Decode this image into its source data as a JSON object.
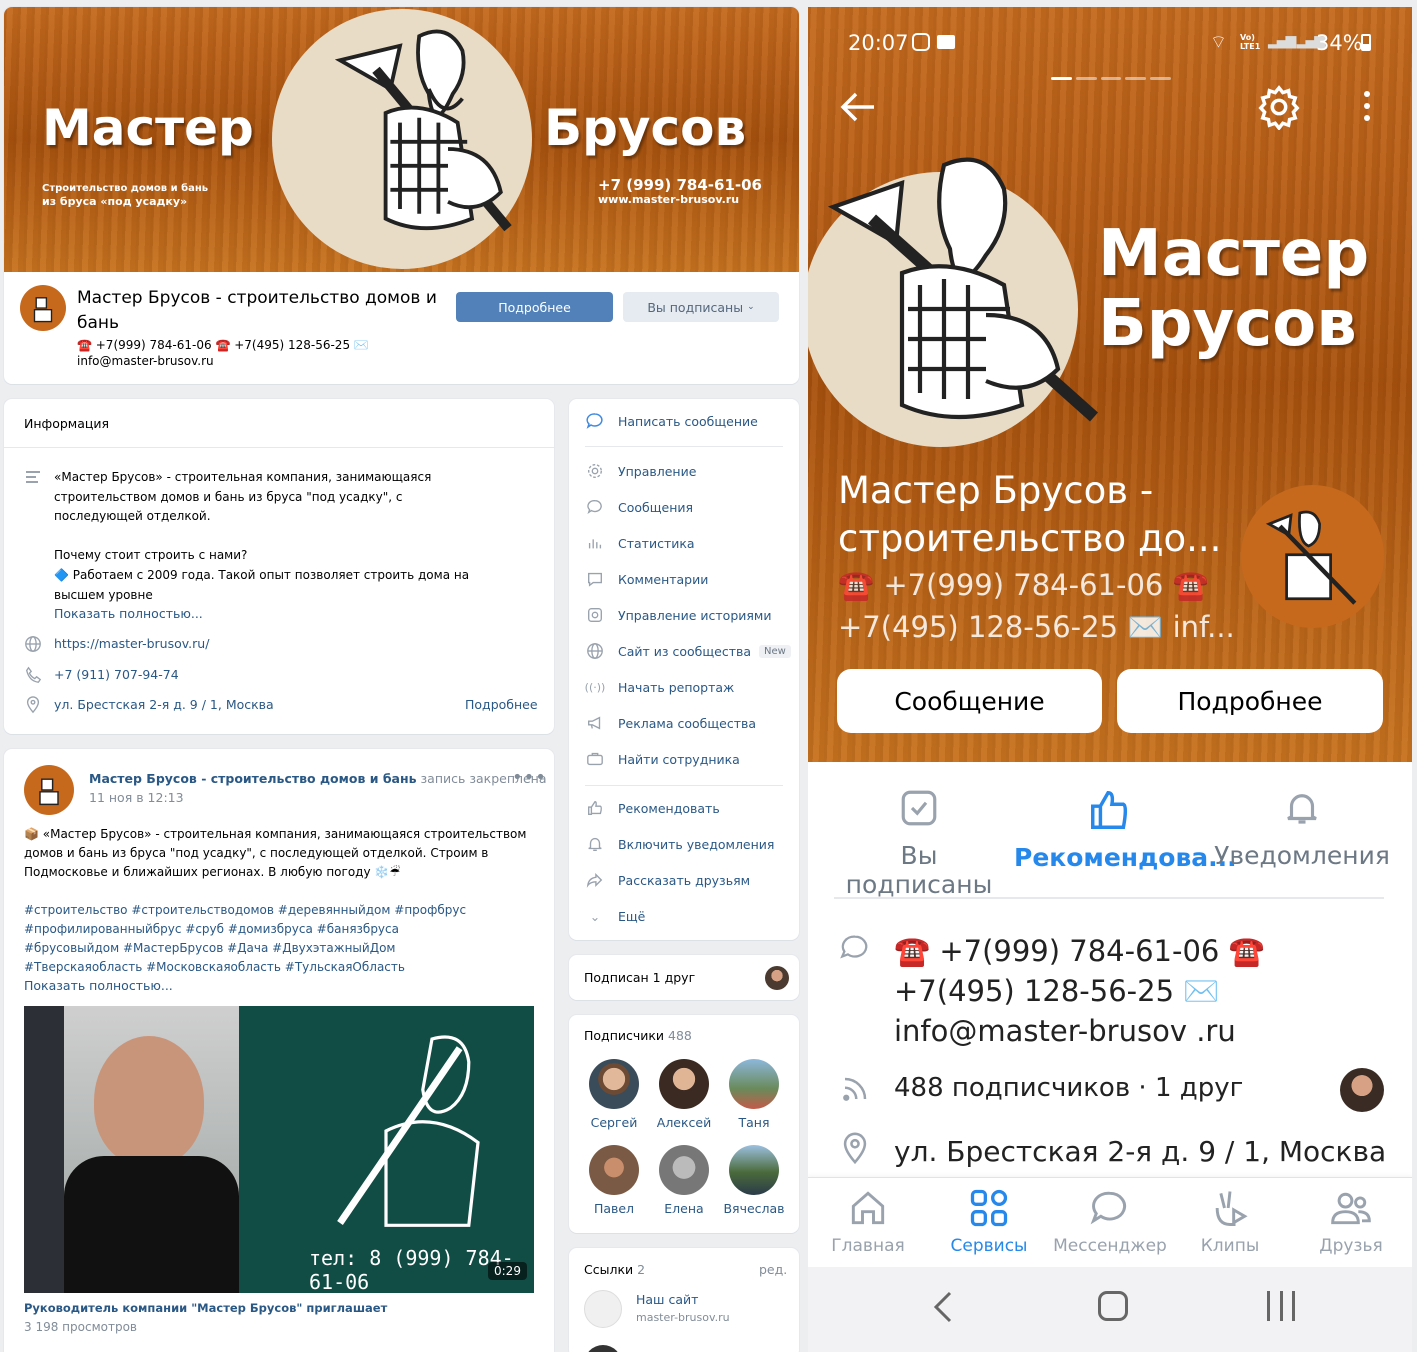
{
  "desktop": {
    "cover": {
      "title_left": "Мастер",
      "title_right": "Брусов",
      "tagline_1": "Строительство домов и бань",
      "tagline_2": "из бруса «под усадку»",
      "phone": "+7 (999) 784-61-06",
      "site": "www.master-brusov.ru"
    },
    "header": {
      "name": "Мастер Брусов - строительство домов и бань",
      "contacts": "☎️ +7(999) 784-61-06 ☎️ +7(495) 128-56-25 ✉️ info@master-brusov.ru",
      "more_button": "Подробнее",
      "subscribed_button": "Вы подписаны"
    },
    "info": {
      "title": "Информация",
      "desc_1": "«Мастер Брусов» - строительная компания, занимающаяся строительством домов и бань из бруса \"под усадку\", с последующей отделкой.",
      "desc_2": "Почему стоит строить с нами?",
      "desc_3": "🔷 Работаем с 2009 года. Такой опыт позволяет строить дома на высшем уровне",
      "show_more": "Показать полностью...",
      "site": "https://master-brusov.ru/",
      "phone": "+7 (911) 707-94-74",
      "address": "ул. Брестская 2-я д. 9 / 1, Москва",
      "details": "Подробнее"
    },
    "post": {
      "author": "Мастер Брусов - строительство домов и бань",
      "pinned": "запись закреплена",
      "date": "11 ноя в 12:13",
      "text": "📦 «Мастер Брусов» - строительная компания, занимающаяся строительством домов и бань из бруса \"под усадку\", с последующей отделкой. Строим в Подмосковье и ближайших регионах. В любую погоду ❄️☔",
      "hashtags": "#строительство #строительстводомов #деревянныйдом #профбрус #профилированныйбрус #сруб #домизбруса #банязбруса #брусовыйдом #МастерБрусов #Дача #ДвухэтажныйДом #Тверскаяобласть #Московскаяобласть #ТульскаяОбласть",
      "show_more": "Показать полностью...",
      "video_phone": "тел: 8 (999) 784-61-06",
      "video_duration": "0:29",
      "video_title": "Руководитель компании \"Мастер Брусов\" приглашает",
      "views": "3 198 просмотров"
    },
    "menu": {
      "write": "Написать сообщение",
      "items": [
        "Управление",
        "Сообщения",
        "Статистика",
        "Комментарии",
        "Управление историями",
        "Сайт из сообщества",
        "Начать репортаж",
        "Реклама сообщества",
        "Найти сотрудника"
      ],
      "new_badge": "New",
      "items2": [
        "Рекомендовать",
        "Включить уведомления",
        "Рассказать друзьям",
        "Ещё"
      ]
    },
    "friend": {
      "label": "Подписан 1 друг"
    },
    "subscribers": {
      "label": "Подписчики",
      "count": "488",
      "people": [
        "Сергей",
        "Алексей",
        "Таня",
        "Павел",
        "Елена",
        "Вячеслав"
      ]
    },
    "links": {
      "label": "Ссылки",
      "count": "2",
      "edit": "ред.",
      "item_title": "Наш сайт",
      "item_url": "master-brusov.ru"
    }
  },
  "mobile": {
    "status": {
      "time": "20:07",
      "battery": "34%",
      "net": "Vo) LTE1"
    },
    "cover": {
      "title_1": "Мастер",
      "title_2": "Брусов"
    },
    "name": "Мастер Брусов - строительство до...",
    "contacts_1": "☎️ +7(999) 784-61-06 ☎️",
    "contacts_2": "+7(495) 128-56-25 ✉️ inf...",
    "btn_message": "Сообщение",
    "btn_more": "Подробнее",
    "actions": [
      "Вы подписаны",
      "Рекомендова...",
      "Уведомления"
    ],
    "info_contacts": "☎️ +7(999) 784-61-06 ☎️ +7(495) 128-56-25 ✉️ info@master-brusov .ru",
    "followers": "488 подписчиков · 1 друг",
    "address": "ул. Брестская 2-я д. 9 / 1, Москва",
    "nav": [
      "Главная",
      "Сервисы",
      "Мессенджер",
      "Клипы",
      "Друзья"
    ]
  },
  "colors": {
    "accent": "#2688eb",
    "vk_blue": "#5181b8",
    "link": "#2a5885",
    "wood": "#b65e17"
  }
}
